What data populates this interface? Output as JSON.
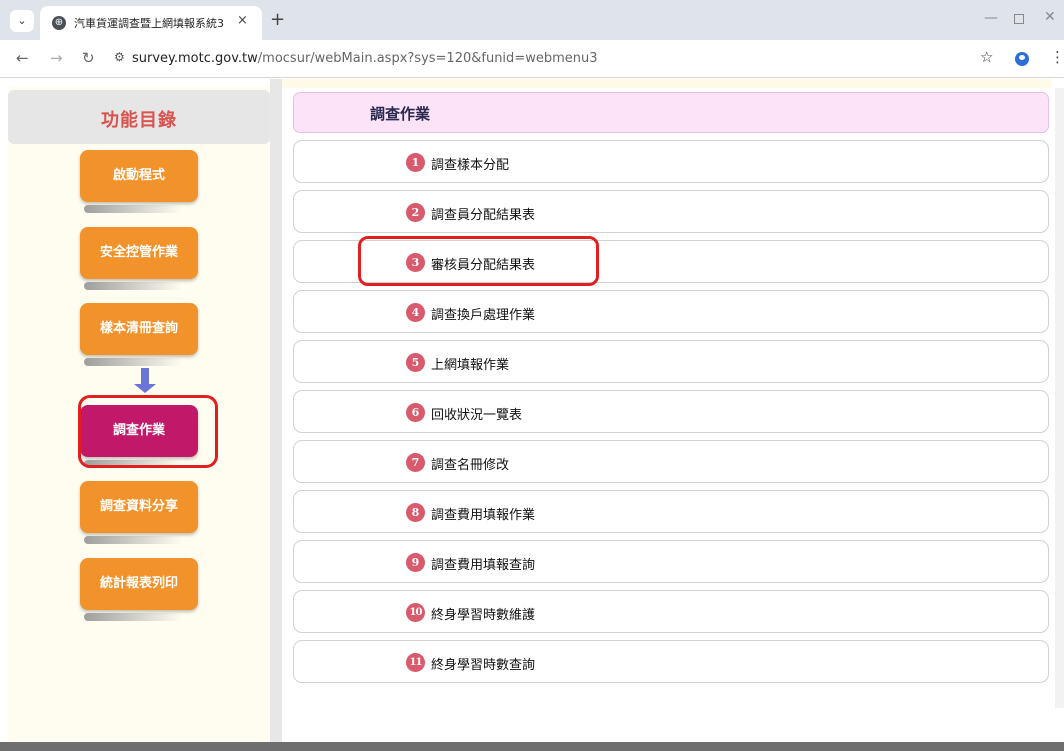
{
  "browser": {
    "tab_title": "汽車貨運調查暨上網填報系統3",
    "tab_close": "×",
    "new_tab": "+",
    "url_host": "survey.motc.gov.tw",
    "url_path": "/mocsur/webMain.aspx?sys=120&funid=webmenu3"
  },
  "sidebar": {
    "title": "功能目錄",
    "items": [
      {
        "label": "啟動程式"
      },
      {
        "label": "安全控管作業"
      },
      {
        "label": "樣本清冊查詢"
      },
      {
        "label": "調查作業"
      },
      {
        "label": "調查資料分享"
      },
      {
        "label": "統計報表列印"
      }
    ],
    "active_index": 3
  },
  "main": {
    "section_title": "調查作業",
    "items": [
      {
        "num": "1",
        "label": "調查樣本分配"
      },
      {
        "num": "2",
        "label": "調查員分配結果表"
      },
      {
        "num": "3",
        "label": "審核員分配結果表"
      },
      {
        "num": "4",
        "label": "調查換戶處理作業"
      },
      {
        "num": "5",
        "label": "上網填報作業"
      },
      {
        "num": "6",
        "label": "回收狀況一覽表"
      },
      {
        "num": "7",
        "label": "調查名冊修改"
      },
      {
        "num": "8",
        "label": "調查費用填報作業"
      },
      {
        "num": "9",
        "label": "調查費用填報查詢"
      },
      {
        "num": "10",
        "label": "終身學習時數維護"
      },
      {
        "num": "11",
        "label": "終身學習時數查詢"
      }
    ]
  },
  "colors": {
    "sidebar_button": "#f2922a",
    "sidebar_button_active": "#c2186a",
    "badge": "#d95a6c",
    "highlight": "#e02020",
    "section_header_bg": "#fde3f7"
  }
}
